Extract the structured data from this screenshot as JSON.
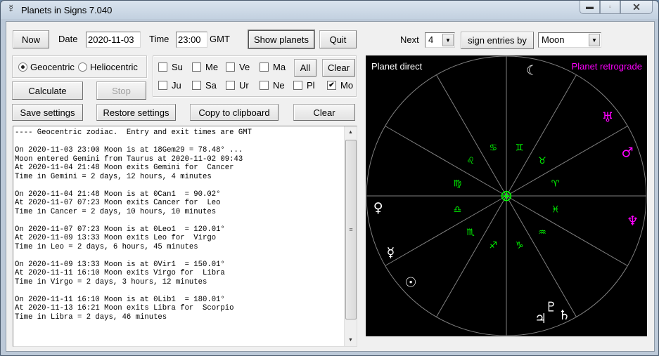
{
  "window": {
    "title": "Planets in Signs 7.040",
    "app_icon": "☿",
    "controls": {
      "minimize": "▬",
      "maximize": "▫",
      "close": "✕"
    }
  },
  "top_bar": {
    "now_label": "Now",
    "date_label": "Date",
    "date_value": "2020-11-03",
    "time_label": "Time",
    "time_value": "23:00",
    "timezone_label": "GMT",
    "show_planets_label": "Show planets",
    "quit_label": "Quit",
    "next_label": "Next",
    "next_count": "4",
    "sign_entries_label": "sign entries by",
    "planet_select_value": "Moon"
  },
  "mode": {
    "geocentric_label": "Geocentric",
    "heliocentric_label": "Heliocentric",
    "selected": "Geocentric"
  },
  "actions": {
    "calculate_label": "Calculate",
    "stop_label": "Stop",
    "save_settings_label": "Save settings",
    "restore_settings_label": "Restore settings",
    "copy_label": "Copy to clipboard",
    "clear_label": "Clear"
  },
  "planet_checks": {
    "row1": [
      {
        "label": "Su",
        "checked": false
      },
      {
        "label": "Me",
        "checked": false
      },
      {
        "label": "Ve",
        "checked": false
      },
      {
        "label": "Ma",
        "checked": false
      }
    ],
    "row2": [
      {
        "label": "Ju",
        "checked": false
      },
      {
        "label": "Sa",
        "checked": false
      },
      {
        "label": "Ur",
        "checked": false
      },
      {
        "label": "Ne",
        "checked": false
      },
      {
        "label": "Pl",
        "checked": false
      },
      {
        "label": "Mo",
        "checked": true
      }
    ],
    "all_label": "All",
    "clear_label": "Clear"
  },
  "log": {
    "lines": [
      "---- Geocentric zodiac.  Entry and exit times are GMT",
      "",
      "On 2020-11-03 23:00 Moon is at 18Gem29 = 78.48° ...",
      "Moon entered Gemini from Taurus at 2020-11-02 09:43",
      "At 2020-11-04 21:48 Moon exits Gemini for  Cancer",
      "Time in Gemini = 2 days, 12 hours, 4 minutes",
      "",
      "On 2020-11-04 21:48 Moon is at 0Can1  = 90.02°",
      "At 2020-11-07 07:23 Moon exits Cancer for  Leo",
      "Time in Cancer = 2 days, 10 hours, 10 minutes",
      "",
      "On 2020-11-07 07:23 Moon is at 0Leo1  = 120.01°",
      "At 2020-11-09 13:33 Moon exits Leo for  Virgo",
      "Time in Leo = 2 days, 6 hours, 45 minutes",
      "",
      "On 2020-11-09 13:33 Moon is at 0Vir1  = 150.01°",
      "At 2020-11-11 16:10 Moon exits Virgo for  Libra",
      "Time in Virgo = 2 days, 3 hours, 12 minutes",
      "",
      "On 2020-11-11 16:10 Moon is at 0Lib1  = 180.01°",
      "At 2020-11-13 16:21 Moon exits Libra for  Scorpio",
      "Time in Libra = 2 days, 46 minutes"
    ]
  },
  "wheel": {
    "direct_label": "Planet direct",
    "retrograde_label": "Planet retrograde",
    "colors": {
      "direct": "#ffffff",
      "retrograde": "#ff00ff",
      "signs": "#00ff00",
      "lines": "#808080",
      "background": "#000000"
    },
    "center_glyph": "⊕",
    "signs": [
      {
        "name": "Aries",
        "glyph": "♈"
      },
      {
        "name": "Taurus",
        "glyph": "♉"
      },
      {
        "name": "Gemini",
        "glyph": "♊"
      },
      {
        "name": "Cancer",
        "glyph": "♋"
      },
      {
        "name": "Leo",
        "glyph": "♌"
      },
      {
        "name": "Virgo",
        "glyph": "♍"
      },
      {
        "name": "Libra",
        "glyph": "♎"
      },
      {
        "name": "Scorpio",
        "glyph": "♏"
      },
      {
        "name": "Sagittarius",
        "glyph": "♐"
      },
      {
        "name": "Capricorn",
        "glyph": "♑"
      },
      {
        "name": "Aquarius",
        "glyph": "♒"
      },
      {
        "name": "Pisces",
        "glyph": "♓"
      }
    ],
    "planets": [
      {
        "name": "Moon",
        "glyph": "☾",
        "longitude": 78.5,
        "retrograde": false
      },
      {
        "name": "Uranus",
        "glyph": "♅",
        "longitude": 38,
        "retrograde": true
      },
      {
        "name": "Mars",
        "glyph": "♂",
        "longitude": 20,
        "retrograde": true
      },
      {
        "name": "Neptune",
        "glyph": "♆",
        "longitude": 349,
        "retrograde": true
      },
      {
        "name": "Venus",
        "glyph": "♀",
        "longitude": 185,
        "retrograde": false
      },
      {
        "name": "Mercury",
        "glyph": "☿",
        "longitude": 206,
        "retrograde": false
      },
      {
        "name": "Sun",
        "glyph": "☉",
        "longitude": 222,
        "retrograde": false
      },
      {
        "name": "Pluto",
        "glyph": "♇",
        "longitude": 292,
        "retrograde": false
      },
      {
        "name": "Jupiter",
        "glyph": "♃",
        "longitude": 290,
        "retrograde": false
      },
      {
        "name": "Saturn",
        "glyph": "♄",
        "longitude": 294,
        "retrograde": false
      }
    ]
  }
}
